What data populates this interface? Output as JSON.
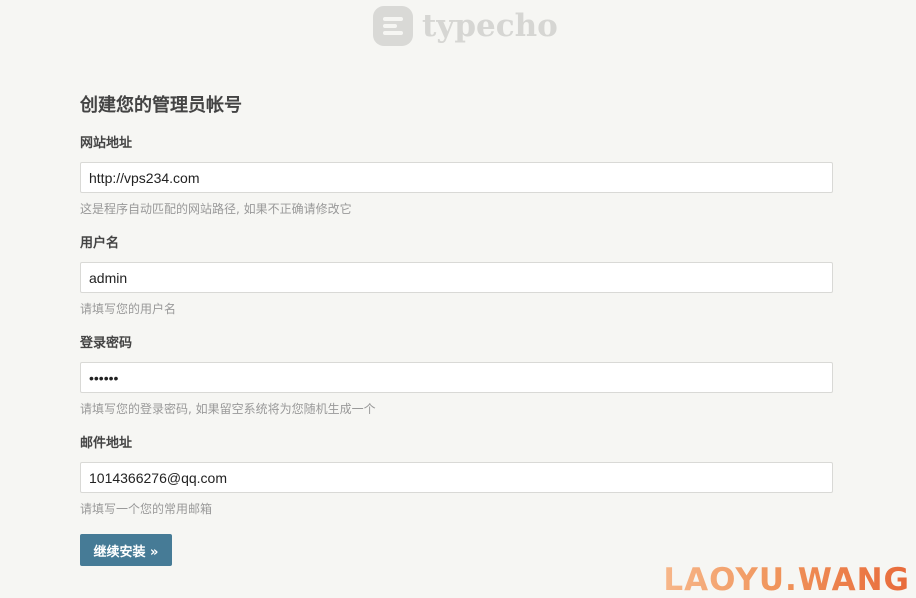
{
  "brand": {
    "logo_text": "typecho",
    "icon": "typecho-logo-icon"
  },
  "page_title": "创建您的管理员帐号",
  "fields": [
    {
      "label": "网站地址",
      "value": "http://vps234.com",
      "hint": "这是程序自动匹配的网站路径, 如果不正确请修改它"
    },
    {
      "label": "用户名",
      "value": "admin",
      "hint": "请填写您的用户名"
    },
    {
      "label": "登录密码",
      "value": "••••••",
      "hint": "请填写您的登录密码, 如果留空系统将为您随机生成一个"
    },
    {
      "label": "邮件地址",
      "value": "1014366276@qq.com",
      "hint": "请填写一个您的常用邮箱"
    }
  ],
  "submit_label": "继续安装 »",
  "watermark": "LAOYU.WANG",
  "colors": {
    "background": "#f6f6f3",
    "button": "#467b96",
    "hint": "#999999"
  }
}
